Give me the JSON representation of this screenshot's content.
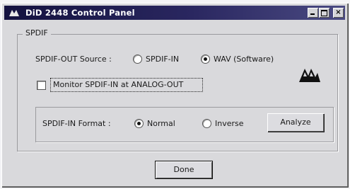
{
  "window": {
    "title": "DiD 2448 Control Panel"
  },
  "spdif_group": {
    "label": "SPDIF",
    "out_source": {
      "label": "SPDIF-OUT Source :",
      "options": [
        {
          "label": "SPDIF-IN",
          "selected": false
        },
        {
          "label": "WAV (Software)",
          "selected": true
        }
      ]
    },
    "monitor": {
      "label": "Monitor SPDIF-IN at ANALOG-OUT",
      "checked": false
    },
    "in_format": {
      "label": "SPDIF-IN Format :",
      "options": [
        {
          "label": "Normal",
          "selected": true
        },
        {
          "label": "Inverse",
          "selected": false
        }
      ],
      "analyze_label": "Analyze"
    }
  },
  "footer": {
    "done_label": "Done"
  },
  "icons": {
    "app": "app-icon",
    "logo": "brand-logo-icon",
    "minimize": "minimize-icon",
    "maximize": "maximize-icon",
    "close": "close-icon"
  },
  "colors": {
    "titlebar_dark": "#14123f",
    "titlebar_light": "#4a4a82",
    "window_face": "#d9d9dc"
  }
}
